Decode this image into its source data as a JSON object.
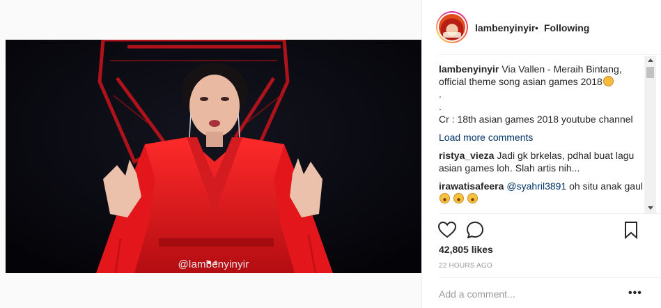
{
  "post": {
    "username": "lambenyinyir",
    "separator": "•",
    "follow_status": "Following"
  },
  "video": {
    "watermark": "@lambenyinyir"
  },
  "caption": {
    "username": "lambenyinyir",
    "line1": "Via Vallen - Meraih Bintang, official theme song asian games 2018",
    "line2": ".",
    "line3": ".",
    "line4": "Cr : 18th asian games 2018 youtube channel"
  },
  "load_more": "Load more comments",
  "comments": [
    {
      "username": "ristya_vieza",
      "text": "Jadi gk brkelas, pdhal buat lagu asian games loh. Slah artis nih..."
    },
    {
      "username": "irawatisafeera",
      "mention": "@syahril3891",
      "text": " oh situ anak gaul "
    }
  ],
  "icons": {
    "like": "heart-icon",
    "comment": "comment-bubble-icon",
    "save": "bookmark-icon",
    "options": "more-options-icon"
  },
  "likes": "42,805 likes",
  "timestamp": "22 HOURS AGO",
  "add_comment": {
    "placeholder": "Add a comment..."
  },
  "more_label": "•••"
}
